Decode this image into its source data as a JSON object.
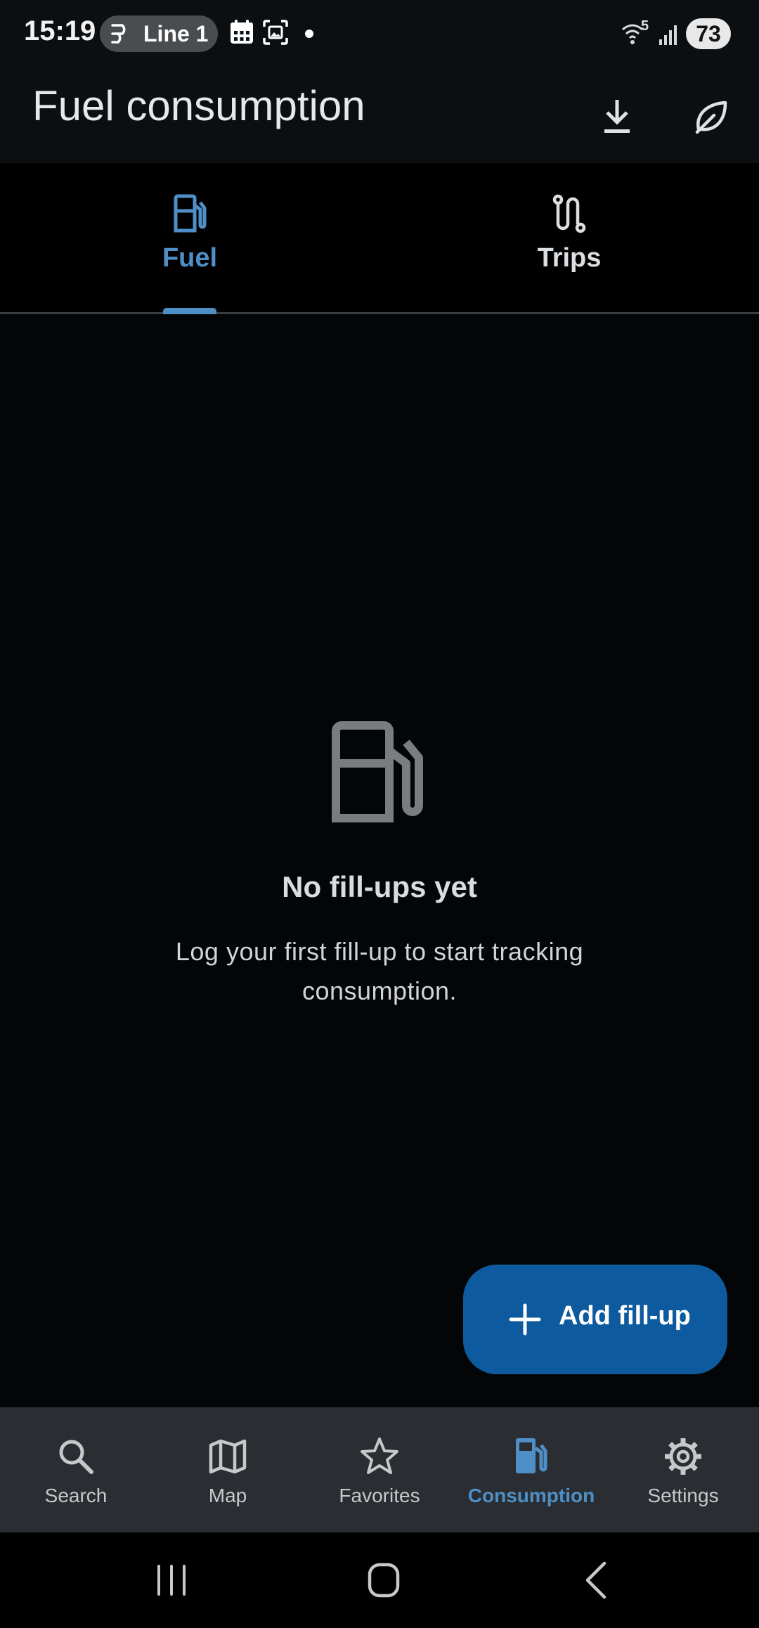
{
  "status_bar": {
    "time": "15:19",
    "pill_label": "Line 1",
    "battery": "73",
    "wifi_badge": "5",
    "icons": [
      "line-pill-icon",
      "calendar-icon",
      "screenshot-icon",
      "notification-dot",
      "wifi-icon",
      "signal-icon",
      "battery-icon"
    ]
  },
  "app_bar": {
    "title": "Fuel consumption",
    "actions": [
      "download-icon",
      "leaf-icon"
    ]
  },
  "tabs": [
    {
      "label": "Fuel",
      "icon": "fuel-pump-icon",
      "active": true
    },
    {
      "label": "Trips",
      "icon": "route-icon",
      "active": false
    }
  ],
  "empty_state": {
    "icon": "fuel-pump-icon",
    "title": "No fill-ups yet",
    "description": "Log your first fill-up to start tracking consumption."
  },
  "fab": {
    "icon": "plus-icon",
    "label": "Add fill-up"
  },
  "bottom_nav": [
    {
      "label": "Search",
      "icon": "search-icon",
      "active": false
    },
    {
      "label": "Map",
      "icon": "map-icon",
      "active": false
    },
    {
      "label": "Favorites",
      "icon": "star-icon",
      "active": false
    },
    {
      "label": "Consumption",
      "icon": "fuel-pump-icon",
      "active": true
    },
    {
      "label": "Settings",
      "icon": "gear-icon",
      "active": false
    }
  ],
  "system_nav": [
    "recents-icon",
    "home-icon",
    "back-icon"
  ],
  "colors": {
    "accent": "#4f8fc7",
    "fab": "#0d5a9e",
    "background": "#040506",
    "appbar": "#0b0f12",
    "bottom_nav": "#2a2e32"
  }
}
